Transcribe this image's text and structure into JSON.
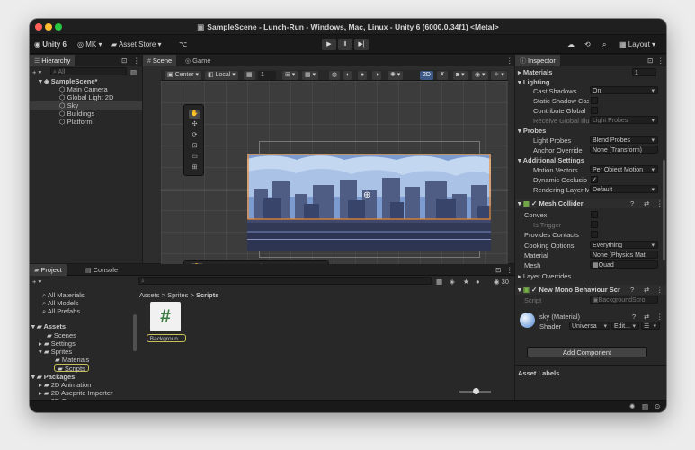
{
  "window": {
    "title": "SampleScene - Lunch-Run - Windows, Mac, Linux - Unity 6 (6000.0.34f1) <Metal>"
  },
  "toolbar": {
    "unity": "Unity 6",
    "account": "MK",
    "asset_store": "Asset Store",
    "layout": "Layout"
  },
  "hierarchy": {
    "tab": "Hierarchy",
    "search_placeholder": "All",
    "scene": "SampleScene*",
    "items": [
      "Main Camera",
      "Global Light 2D",
      "Sky",
      "Buildings",
      "Platform"
    ]
  },
  "scene": {
    "tabs": [
      "Scene",
      "Game"
    ],
    "pivot": "Center",
    "space": "Local",
    "snap": "1",
    "mode2d": "2D"
  },
  "project": {
    "tabs": [
      "Project",
      "Console"
    ],
    "favorites": [
      "All Materials",
      "All Models",
      "All Prefabs"
    ],
    "assets_label": "Assets",
    "folders": [
      "Scenes",
      "Settings",
      "Sprites",
      "Materials",
      "Scripts"
    ],
    "packages_label": "Packages",
    "packages": [
      "2D Animation",
      "2D Aseprite Importer",
      "2D Common"
    ],
    "breadcrumb": [
      "Assets",
      "Sprites",
      "Scripts"
    ],
    "file_name": "Backgroun...",
    "visible_count": "30"
  },
  "inspector": {
    "tab": "Inspector",
    "materials_label": "Materials",
    "materials_count": "1",
    "lighting": "Lighting",
    "cast_shadows": "Cast Shadows",
    "cast_shadows_value": "On",
    "static_shadow": "Static Shadow Cas",
    "contribute_gi": "Contribute Global",
    "receive_gi": "Receive Global Illu",
    "receive_gi_value": "Light Probes",
    "probes": "Probes",
    "light_probes": "Light Probes",
    "light_probes_value": "Blend Probes",
    "anchor_override": "Anchor Override",
    "anchor_value": "None (Transform)",
    "additional": "Additional Settings",
    "motion_vectors": "Motion Vectors",
    "motion_value": "Per Object Motion",
    "dynamic_occlusion": "Dynamic Occlusio",
    "rendering_layer": "Rendering Layer M",
    "rendering_value": "Default",
    "mesh_collider": "Mesh Collider",
    "convex": "Convex",
    "is_trigger": "Is Trigger",
    "provides_contacts": "Provides Contacts",
    "cooking": "Cooking Options",
    "cooking_value": "Everything",
    "material": "Material",
    "material_value": "None (Physics Mat",
    "mesh": "Mesh",
    "mesh_value": "Quad",
    "layer_overrides": "Layer Overrides",
    "script_component": "New Mono Behaviour Scr",
    "script_label": "Script",
    "script_value": "BackgroundScro",
    "material_name": "sky (Material)",
    "shader": "Shader",
    "shader_value": "Universa",
    "edit": "Edit...",
    "add_component": "Add Component",
    "asset_labels": "Asset Labels"
  }
}
